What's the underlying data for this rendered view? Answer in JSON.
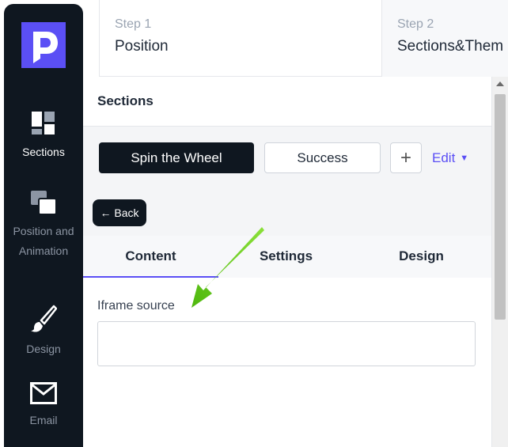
{
  "sidebar": {
    "logo_icon": "brand-logo-icon",
    "items": [
      {
        "label": "Sections",
        "icon": "sections-grid-icon",
        "active": true
      },
      {
        "label": "Position and Animation",
        "icon": "layers-icon",
        "active": false
      },
      {
        "label": "Design",
        "icon": "brush-icon",
        "active": false
      },
      {
        "label": "Email",
        "icon": "envelope-icon",
        "active": false
      }
    ]
  },
  "steps": [
    {
      "number": "Step 1",
      "title": "Position"
    },
    {
      "number": "Step 2",
      "title": "Sections&Them"
    }
  ],
  "panel": {
    "heading": "Sections",
    "section_tabs": {
      "active": "Spin the Wheel",
      "second": "Success",
      "add_symbol": "+",
      "edit_label": "Edit"
    },
    "back_label": "← Back",
    "subtabs": [
      "Content",
      "Settings",
      "Design"
    ],
    "active_subtab": "Content",
    "field": {
      "label": "Iframe source",
      "value": "",
      "placeholder": ""
    }
  },
  "colors": {
    "sidebar_bg": "#0f1720",
    "accent": "#5b4ff5",
    "arrow": "#66cc1a"
  }
}
